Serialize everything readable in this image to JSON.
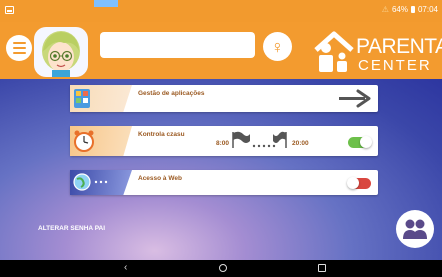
{
  "status_bar": {
    "battery_text": "64%",
    "time": "07:04"
  },
  "header": {
    "name_input_value": "",
    "gender_symbol": "♀",
    "logo_line1": "PARENTAL",
    "logo_line2": "CENTER"
  },
  "cards": {
    "apps": {
      "label": "Gestão de aplicações",
      "icon": "apps-icon"
    },
    "time": {
      "label": "Kontrola czasu",
      "start": "8:00",
      "end": "20:00",
      "enabled": true,
      "icon": "clock-icon"
    },
    "web": {
      "label": "Acesso à Web",
      "enabled": false,
      "icon": "globe-icon"
    }
  },
  "footer": {
    "change_password": "ALTERAR SENHA PAI"
  },
  "colors": {
    "header": "#f39b2f",
    "card_text": "#9b5a22",
    "toggle_on": "#6dc04a",
    "toggle_off": "#d9473f"
  },
  "nav": {
    "back_glyph": "‹"
  }
}
